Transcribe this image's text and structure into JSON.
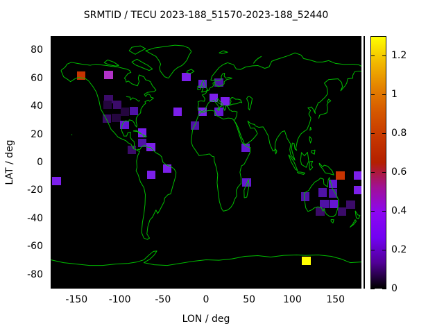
{
  "title": "SRMTID / TECU 2023-188_51570-2023-188_52440",
  "axes": {
    "x_label": "LON / deg",
    "y_label": "LAT / deg",
    "x_ticks": [
      -150,
      -100,
      -50,
      0,
      50,
      100,
      150
    ],
    "y_ticks": [
      80,
      60,
      40,
      20,
      0,
      -20,
      -40,
      -60,
      -80
    ]
  },
  "colorbar": {
    "min": 0,
    "max": 1.3,
    "tick_labels": [
      "1.2",
      "1",
      "0.8",
      "0.6",
      "0.4",
      "0.2",
      "0"
    ],
    "tick_values": [
      1.2,
      1,
      0.8,
      0.6,
      0.4,
      0.2,
      0
    ],
    "palette": [
      [
        0.0,
        "#000000"
      ],
      [
        0.1,
        "#510096"
      ],
      [
        0.2,
        "#7202f2"
      ],
      [
        0.3,
        "#8c07f2"
      ],
      [
        0.4,
        "#a11096"
      ],
      [
        0.5,
        "#b42000"
      ],
      [
        0.6,
        "#c63700"
      ],
      [
        0.7,
        "#d55700"
      ],
      [
        0.8,
        "#e48300"
      ],
      [
        0.9,
        "#f2ba00"
      ],
      [
        1.0,
        "#ffff00"
      ]
    ]
  },
  "colors": {
    "background": "#ffffff",
    "map_background": "#000000",
    "coastline": "#00bf00",
    "text": "#000000"
  },
  "chart_data": {
    "type": "heatmap",
    "title": "SRMTID / TECU 2023-188_51570-2023-188_52440",
    "xlabel": "LON / deg",
    "ylabel": "LAT / deg",
    "xlim": [
      -180,
      180
    ],
    "ylim": [
      -90,
      90
    ],
    "grid": false,
    "colorbar_range": [
      0,
      1.3
    ],
    "cell_size_deg": [
      10,
      6
    ],
    "points": [
      {
        "lon": -173,
        "lat": -13.5,
        "value": 0.3,
        "color": "#7c1fea"
      },
      {
        "lon": -144.5,
        "lat": 62,
        "value": 0.78,
        "color": "#c73300"
      },
      {
        "lon": -113,
        "lat": 62.5,
        "value": 0.55,
        "color": "#b232c8"
      },
      {
        "lon": -23,
        "lat": 61,
        "value": 0.3,
        "color": "#7c1fea"
      },
      {
        "lon": -4,
        "lat": 56,
        "value": 0.24,
        "color": "#6517d2"
      },
      {
        "lon": 15,
        "lat": 57,
        "value": 0.18,
        "color": "#4f12a6"
      },
      {
        "lon": -113,
        "lat": 45,
        "value": 0.12,
        "color": "#3b0b69"
      },
      {
        "lon": -114,
        "lat": 41,
        "value": 0.07,
        "color": "#24063e"
      },
      {
        "lon": -103,
        "lat": 41,
        "value": 0.12,
        "color": "#3b0b69"
      },
      {
        "lon": -94,
        "lat": 36,
        "value": 0.07,
        "color": "#24063e"
      },
      {
        "lon": -83.5,
        "lat": 36.5,
        "value": 0.18,
        "color": "#4f12a6"
      },
      {
        "lon": -115,
        "lat": 31,
        "value": 0.12,
        "color": "#3b0b69"
      },
      {
        "lon": -104,
        "lat": 31.5,
        "value": 0.07,
        "color": "#24063e"
      },
      {
        "lon": -94.5,
        "lat": 26.5,
        "value": 0.24,
        "color": "#6517d2"
      },
      {
        "lon": -74,
        "lat": 21,
        "value": 0.3,
        "color": "#7c1fea"
      },
      {
        "lon": -74,
        "lat": 14,
        "value": 0.18,
        "color": "#4f12a6"
      },
      {
        "lon": -86,
        "lat": 9,
        "value": 0.12,
        "color": "#3b0b69"
      },
      {
        "lon": -64,
        "lat": 11,
        "value": 0.3,
        "color": "#7c1fea"
      },
      {
        "lon": -63.5,
        "lat": -9,
        "value": 0.3,
        "color": "#7c1fea"
      },
      {
        "lon": -45,
        "lat": -4.5,
        "value": 0.3,
        "color": "#7c1fea"
      },
      {
        "lon": -33,
        "lat": 36,
        "value": 0.3,
        "color": "#7c1fea"
      },
      {
        "lon": -13,
        "lat": 26,
        "value": 0.18,
        "color": "#4f12a6"
      },
      {
        "lon": 9,
        "lat": 46,
        "value": 0.3,
        "color": "#7c1fea"
      },
      {
        "lon": 22,
        "lat": 43.5,
        "value": 0.3,
        "color": "#7c1fea"
      },
      {
        "lon": -4,
        "lat": 36,
        "value": 0.3,
        "color": "#7c1fea"
      },
      {
        "lon": 15,
        "lat": 36,
        "value": 0.24,
        "color": "#6517d2"
      },
      {
        "lon": 46,
        "lat": 10.5,
        "value": 0.24,
        "color": "#6517d2"
      },
      {
        "lon": 47,
        "lat": -14.5,
        "value": 0.24,
        "color": "#6517d2"
      },
      {
        "lon": 155.5,
        "lat": -9.5,
        "value": 0.78,
        "color": "#c73300"
      },
      {
        "lon": 176.5,
        "lat": -9.5,
        "value": 0.3,
        "color": "#7c1fea"
      },
      {
        "lon": 176.5,
        "lat": -20,
        "value": 0.3,
        "color": "#7c1fea"
      },
      {
        "lon": 147,
        "lat": -15.5,
        "value": 0.24,
        "color": "#6517d2"
      },
      {
        "lon": 147,
        "lat": -22,
        "value": 0.18,
        "color": "#4f12a6"
      },
      {
        "lon": 135,
        "lat": -21.5,
        "value": 0.18,
        "color": "#4f12a6"
      },
      {
        "lon": 115,
        "lat": -24.5,
        "value": 0.18,
        "color": "#4f12a6"
      },
      {
        "lon": 137,
        "lat": -29.5,
        "value": 0.18,
        "color": "#4f12a6"
      },
      {
        "lon": 148,
        "lat": -29.5,
        "value": 0.24,
        "color": "#6517d2"
      },
      {
        "lon": 167.5,
        "lat": -30,
        "value": 0.12,
        "color": "#3b0b69"
      },
      {
        "lon": 132,
        "lat": -35,
        "value": 0.12,
        "color": "#3b0b69"
      },
      {
        "lon": 157.5,
        "lat": -35,
        "value": 0.12,
        "color": "#3b0b69"
      },
      {
        "lon": 116,
        "lat": -70,
        "value": 1.28,
        "color": "#ffff00"
      }
    ]
  }
}
